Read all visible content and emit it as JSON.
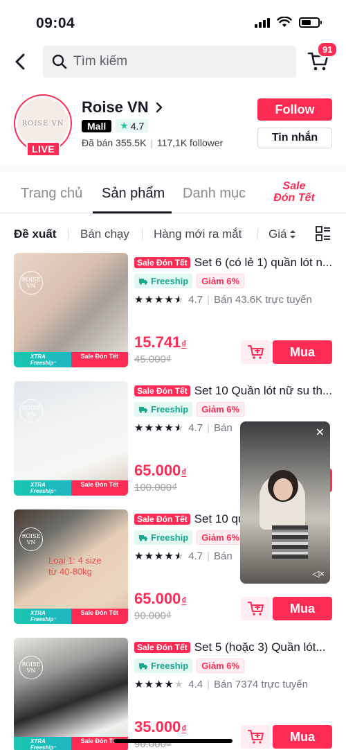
{
  "status": {
    "time": "09:04"
  },
  "search": {
    "placeholder": "Tìm kiếm"
  },
  "cart": {
    "badge": "91"
  },
  "shop": {
    "name": "Roise VN",
    "avatar_text": "ROISE VN",
    "live_label": "LIVE",
    "mall_label": "Mall",
    "rating": "4.7",
    "sold": "Đã bán 355.5K",
    "followers": "117,1K follower",
    "follow_label": "Follow",
    "message_label": "Tin nhắn"
  },
  "tabs": {
    "items": [
      "Trang chủ",
      "Sản phẩm",
      "Danh mục"
    ],
    "active": "Sản phẩm",
    "sale_line1": "Sale",
    "sale_line2": "Đón Tết"
  },
  "sort": {
    "items": [
      "Đề xuất",
      "Bán chạy",
      "Hàng mới ra mắt",
      "Giá"
    ],
    "active": "Đề xuất"
  },
  "products": [
    {
      "tag": "Sale Đón Tết",
      "title": "Set 6 (có lẻ 1) quần lót n...",
      "freeship": "Freeship",
      "discount": "Giảm 6%",
      "rating": "4.7",
      "stars": 4.5,
      "sold": "Bán 43.6K trực tuyến",
      "price": "15.741",
      "currency": "₫",
      "old_price": "45.000₫",
      "buy_label": "Mua",
      "brand": "ROISE VN",
      "banner_xtra": "XTRA",
      "banner_freeship": "Freeship⁺",
      "banner_sale": "Sale Đón Tết",
      "photo": "linear-gradient(135deg,#e9d6c8 0%,#d9bfae 40%,#a7a09a 60%,#ece6e0 100%)"
    },
    {
      "tag": "Sale Đón Tết",
      "title": "Set 10 Quần lót nữ su th...",
      "freeship": "Freeship",
      "discount": "Giảm 6%",
      "rating": "4.7",
      "stars": 4.5,
      "sold": "Bán",
      "price": "65.000",
      "currency": "₫",
      "old_price": "100.000₫",
      "buy_label": "Mua",
      "brand": "ROISE VN",
      "banner_xtra": "XTRA",
      "banner_freeship": "Freeship⁺",
      "banner_sale": "Sale Đón Tết",
      "photo": "linear-gradient(160deg,#dfe6ec 0%,#f4f4f2 40%,#f6f6f4 70%,#d8c7b8 100%)"
    },
    {
      "tag": "Sale Đón Tết",
      "title": "Set 10 qu",
      "freeship": "Freeship",
      "discount": "Giảm 6%",
      "rating": "4.7",
      "stars": 4.5,
      "sold": "Bán",
      "price": "65.000",
      "currency": "₫",
      "old_price": "90.000₫",
      "buy_label": "Mua",
      "brand": "ROISE VN",
      "overlay_line1": "Loại 1: 4 size",
      "overlay_line2": "từ 40-80kg",
      "banner_xtra": "XTRA",
      "banner_freeship": "Freeship⁺",
      "banner_sale": "Sale Đón Tết",
      "photo": "linear-gradient(145deg,#4a3b33 0%,#6d6e6a 25%,#e6cdb6 50%,#ecd5c0 80%,#d8b79f 100%)"
    },
    {
      "tag": "Sale Đón Tết",
      "title": "Set 5 (hoặc 3) Quần lót...",
      "freeship": "Freeship",
      "discount": "Giảm 6%",
      "rating": "4.4",
      "stars": 4,
      "sold": "Bán 7374 trực tuyến",
      "price": "35.000",
      "currency": "₫",
      "old_price": "90.000₫",
      "buy_label": "Mua",
      "brand": "ROISE VN",
      "banner_xtra": "XTRA",
      "banner_freeship": "Freeship⁺",
      "banner_sale": "Sale Đón Tết",
      "photo": "linear-gradient(160deg,#e8e6e2 0%,#9a9a98 30%,#2b2b2b 55%,#f1f0ee 80%,#d9d6d1 100%)"
    }
  ]
}
